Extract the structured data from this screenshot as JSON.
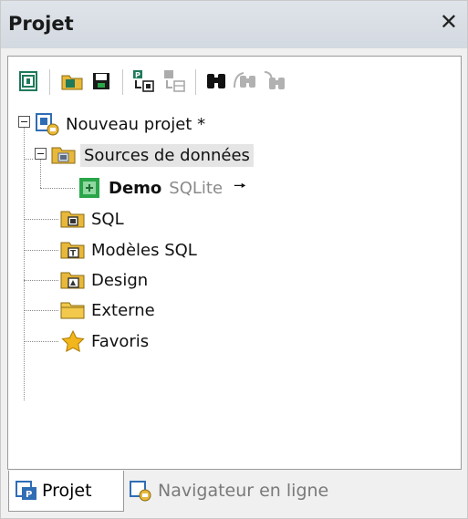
{
  "panel": {
    "title": "Projet"
  },
  "toolbar": {
    "buttons": [
      "new-project",
      "open-project",
      "save-project",
      "add-file-to-project",
      "add-active-file",
      "find",
      "find-next",
      "find-previous"
    ]
  },
  "tree": {
    "root": "Nouveau projet *",
    "data_sources": "Sources de données",
    "demo": {
      "name": "Demo",
      "type": "SQLite",
      "arrow": "🠖"
    },
    "folders": [
      "SQL",
      "Modèles SQL",
      "Design",
      "Externe",
      "Favoris"
    ]
  },
  "tabs": {
    "active": "Projet",
    "inactive": "Navigateur en ligne"
  },
  "colors": {
    "folder": "#e8b83a",
    "accent_blue": "#2f6db5",
    "db_green": "#2aa54a"
  }
}
